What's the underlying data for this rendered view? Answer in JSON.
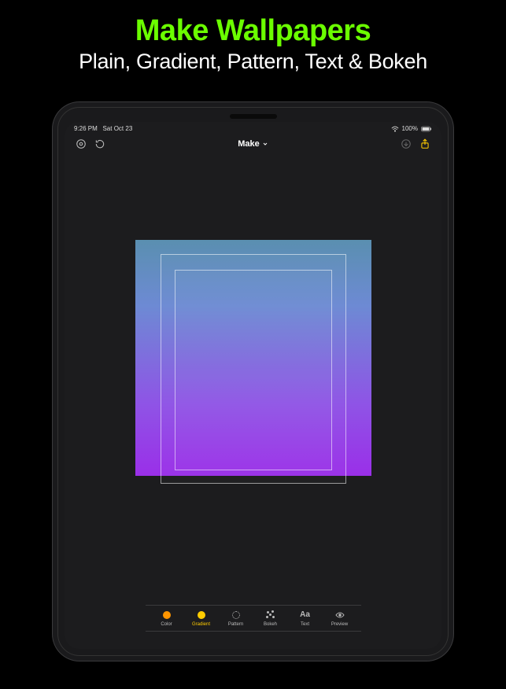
{
  "promo": {
    "title": "Make Wallpapers",
    "subtitle": "Plain, Gradient, Pattern, Text & Bokeh"
  },
  "statusbar": {
    "time": "9:26 PM",
    "date": "Sat Oct 23",
    "battery": "100%"
  },
  "toolbar": {
    "title": "Make"
  },
  "bottom": {
    "items": [
      {
        "label": "Color",
        "icon": "circle",
        "active": false
      },
      {
        "label": "Gradient",
        "icon": "circle",
        "active": true
      },
      {
        "label": "Pattern",
        "icon": "pattern",
        "active": false
      },
      {
        "label": "Bokeh",
        "icon": "bokeh",
        "active": false
      },
      {
        "label": "Text",
        "icon": "aa",
        "active": false
      },
      {
        "label": "Preview",
        "icon": "eye",
        "active": false
      }
    ]
  },
  "colors": {
    "accent": "#ffcc00",
    "gradient_top": "#5a8fb0",
    "gradient_bottom": "#9a2fe8"
  }
}
